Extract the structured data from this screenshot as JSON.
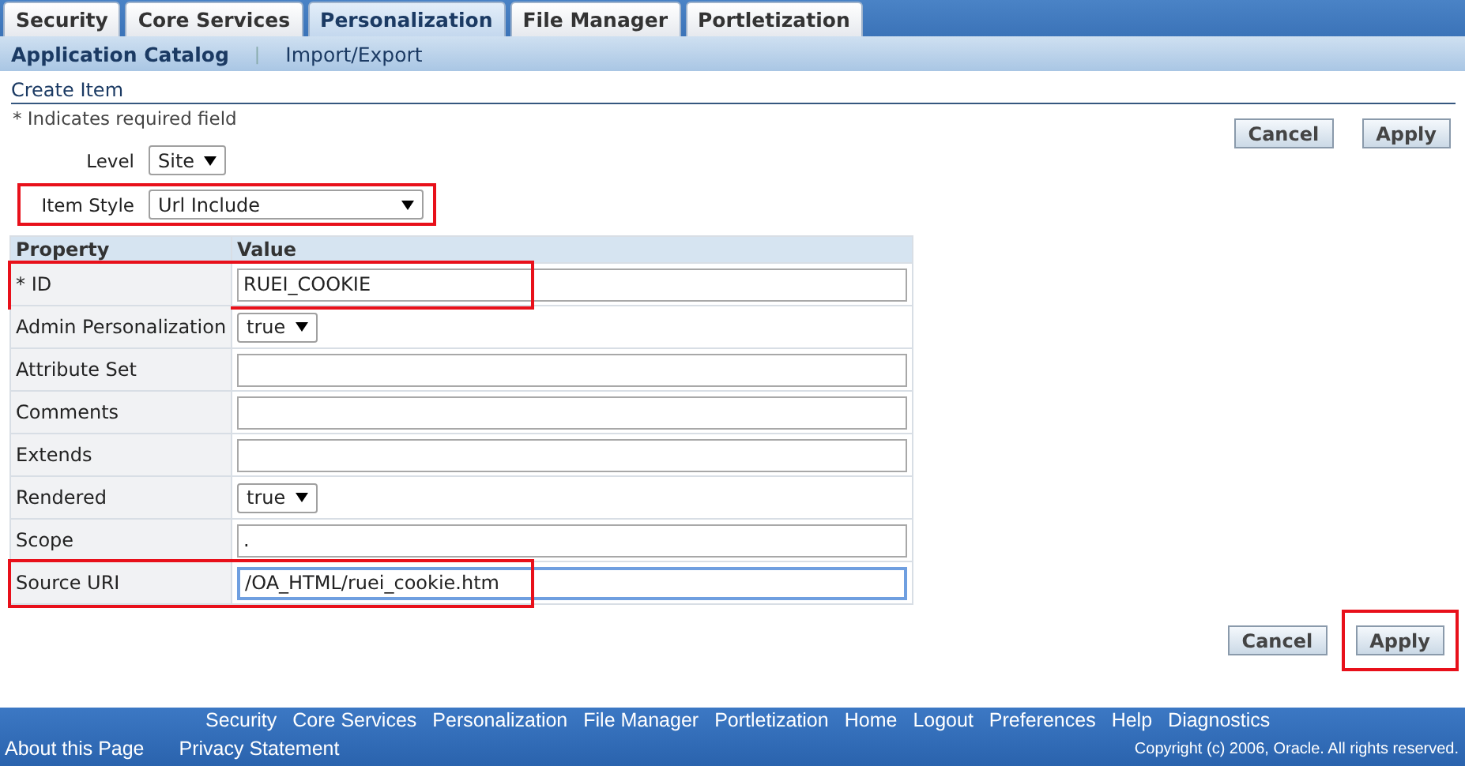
{
  "tabs": [
    {
      "label": "Security",
      "selected": false
    },
    {
      "label": "Core Services",
      "selected": false
    },
    {
      "label": "Personalization",
      "selected": true
    },
    {
      "label": "File Manager",
      "selected": false
    },
    {
      "label": "Portletization",
      "selected": false
    }
  ],
  "subtabs": [
    {
      "label": "Application Catalog",
      "selected": true
    },
    {
      "label": "Import/Export",
      "selected": false
    }
  ],
  "subtab_separator": "|",
  "header": {
    "title": "Create Item",
    "required_note": "* Indicates required field"
  },
  "top_buttons": [
    {
      "label": "Cancel",
      "highlighted": false
    },
    {
      "label": "Apply",
      "highlighted": false
    }
  ],
  "fields": [
    {
      "label": "Level",
      "value": "Site",
      "wide": false,
      "highlighted": false
    },
    {
      "label": "Item Style",
      "value": "Url Include",
      "wide": true,
      "highlighted": true
    }
  ],
  "table": {
    "columns": [
      "Property",
      "Value"
    ],
    "rows": [
      {
        "property": "* ID",
        "kind": "text",
        "value": "RUEI_COOKIE",
        "highlighted": true,
        "focused": false
      },
      {
        "property": "Admin Personalization",
        "kind": "select",
        "value": "true",
        "highlighted": false,
        "focused": false
      },
      {
        "property": "Attribute Set",
        "kind": "text",
        "value": "",
        "highlighted": false,
        "focused": false
      },
      {
        "property": "Comments",
        "kind": "text",
        "value": "",
        "highlighted": false,
        "focused": false
      },
      {
        "property": "Extends",
        "kind": "text",
        "value": "",
        "highlighted": false,
        "focused": false
      },
      {
        "property": "Rendered",
        "kind": "select",
        "value": "true",
        "highlighted": false,
        "focused": false
      },
      {
        "property": "Scope",
        "kind": "text",
        "value": ".",
        "highlighted": false,
        "focused": false
      },
      {
        "property": "Source URI",
        "kind": "text",
        "value": "/OA_HTML/ruei_cookie.htm",
        "highlighted": true,
        "focused": true
      }
    ]
  },
  "bottom_buttons": [
    {
      "label": "Cancel",
      "highlighted": false
    },
    {
      "label": "Apply",
      "highlighted": true
    }
  ],
  "footer": {
    "links": [
      "Security",
      "Core Services",
      "Personalization",
      "File Manager",
      "Portletization",
      "Home",
      "Logout",
      "Preferences",
      "Help",
      "Diagnostics"
    ],
    "bottom_links": [
      "About this Page",
      "Privacy Statement"
    ],
    "copyright": "Copyright (c) 2006, Oracle. All rights reserved."
  }
}
